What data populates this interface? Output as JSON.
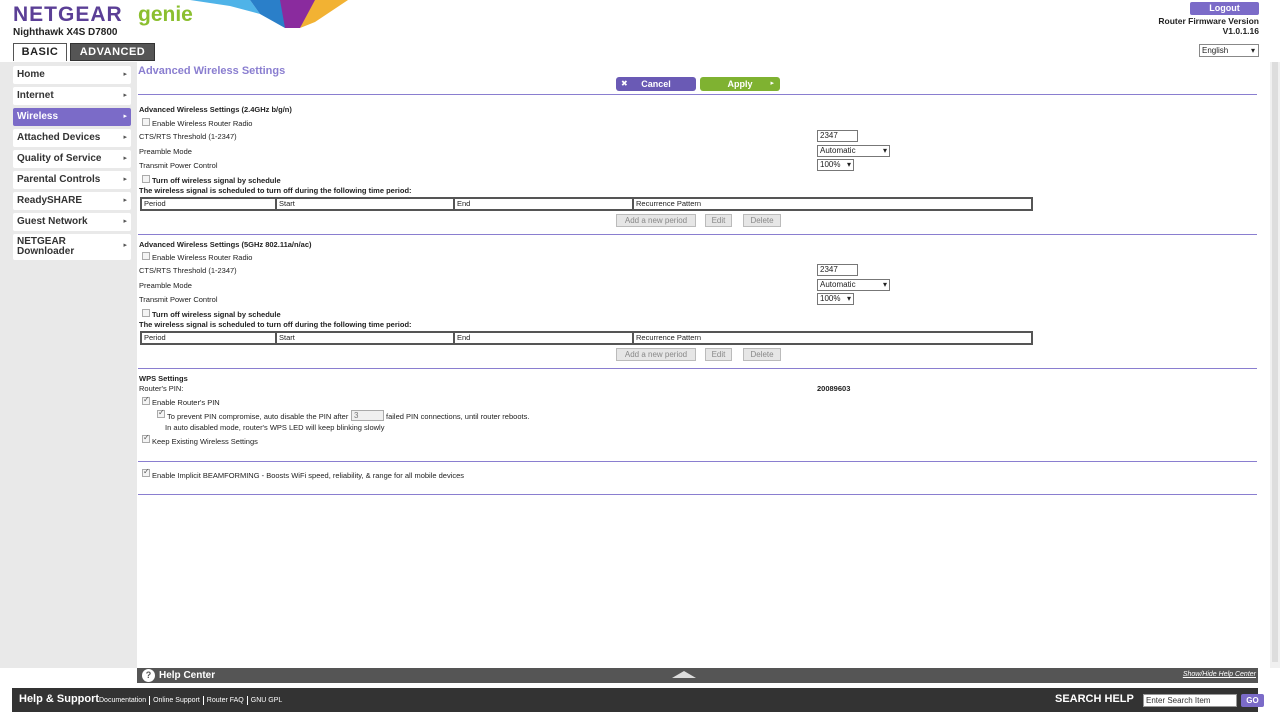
{
  "header": {
    "logo_netgear": "NETGEAR",
    "logo_genie": "genie",
    "model": "Nighthawk X4S D7800",
    "logout": "Logout",
    "firmware_label": "Router Firmware Version",
    "firmware_value": "V1.0.1.16",
    "language": "English",
    "tabs": [
      {
        "label": "BASIC"
      },
      {
        "label": "ADVANCED"
      }
    ]
  },
  "sidebar": {
    "items": [
      {
        "label": "Home"
      },
      {
        "label": "Internet"
      },
      {
        "label": "Wireless"
      },
      {
        "label": "Attached Devices"
      },
      {
        "label": "Quality of Service"
      },
      {
        "label": "Parental Controls"
      },
      {
        "label": "ReadySHARE"
      },
      {
        "label": "Guest Network"
      },
      {
        "label": "NETGEAR"
      },
      {
        "label": "Downloader"
      }
    ]
  },
  "main": {
    "title": "Advanced Wireless Settings",
    "cancel": "Cancel",
    "apply": "Apply",
    "band24": {
      "title": "Advanced Wireless Settings (2.4GHz b/g/n)",
      "enable_radio": "Enable Wireless Router Radio",
      "cts_label": "CTS/RTS Threshold (1-2347)",
      "cts_value": "2347",
      "preamble_label": "Preamble Mode",
      "preamble_value": "Automatic",
      "power_label": "Transmit Power Control",
      "power_value": "100%",
      "schedule_cb": "Turn off wireless signal by schedule",
      "schedule_note": "The wireless signal is scheduled to turn off during the following time period:"
    },
    "band5": {
      "title": "Advanced Wireless Settings (5GHz 802.11a/n/ac)",
      "enable_radio": "Enable Wireless Router Radio",
      "cts_label": "CTS/RTS Threshold (1-2347)",
      "cts_value": "2347",
      "preamble_label": "Preamble Mode",
      "preamble_value": "Automatic",
      "power_label": "Transmit Power Control",
      "power_value": "100%",
      "schedule_cb": "Turn off wireless signal by schedule",
      "schedule_note": "The wireless signal is scheduled to turn off during the following time period:"
    },
    "table_headers": [
      "Period",
      "Start",
      "End",
      "Recurrence Pattern"
    ],
    "add_period": "Add a new period",
    "edit": "Edit",
    "delete": "Delete",
    "wps": {
      "title": "WPS Settings",
      "pin_label": "Router's PIN:",
      "pin_value": "20089603",
      "enable_pin": "Enable Router's PIN",
      "prevent_pre": "To prevent PIN compromise, auto disable the PIN after",
      "prevent_value": "3",
      "prevent_post": "failed PIN connections, until router reboots.",
      "auto_note": "In auto disabled mode, router's WPS LED will keep blinking slowly",
      "keep_existing": "Keep Existing Wireless Settings"
    },
    "beamforming": "Enable Implicit BEAMFORMING - Boosts WiFi speed, reliability, & range for all mobile devices"
  },
  "help": {
    "title": "Help Center",
    "show_hide": "Show/Hide Help Center"
  },
  "footer": {
    "title": "Help & Support",
    "links": [
      "Documentation",
      "Online Support",
      "Router FAQ",
      "GNU GPL"
    ],
    "search_label": "SEARCH HELP",
    "search_value": "Enter Search Item",
    "go": "GO"
  },
  "colors": {
    "accent": "#7b6bc8",
    "apply_green": "#7fb231",
    "title_purple": "#8a7ed0"
  }
}
